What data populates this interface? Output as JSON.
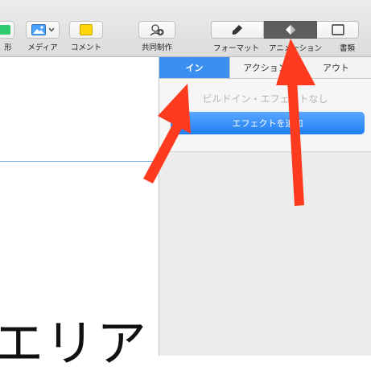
{
  "toolbar": {
    "shape_label_partial": "形",
    "media_label": "メディア",
    "comment_label": "コメント",
    "collaborate_label": "共同制作",
    "format_label": "フォーマット",
    "animate_label": "アニメーション",
    "document_label": "書類",
    "active_tab": "animate"
  },
  "canvas": {
    "text": "エリア"
  },
  "inspector": {
    "tabs": [
      {
        "label": "イン",
        "active": true
      },
      {
        "label": "アクション",
        "active": false
      },
      {
        "label": "アウト",
        "active": false
      }
    ],
    "no_effect_text": "ビルドイン・エフェクトなし",
    "add_effect_label": "エフェクトを追加"
  },
  "colors": {
    "accent": "#3b8ff0",
    "arrow": "#ff3b1f"
  }
}
